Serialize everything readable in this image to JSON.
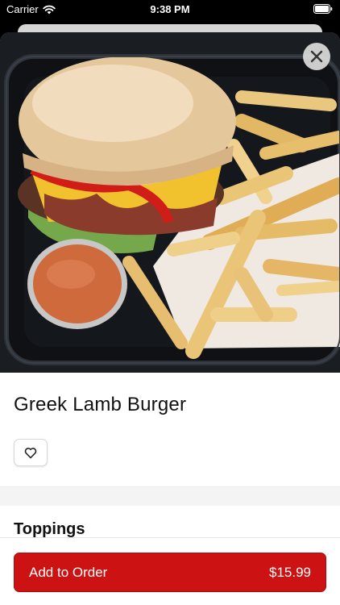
{
  "status_bar": {
    "carrier": "Carrier",
    "time": "9:38 PM"
  },
  "item": {
    "title": "Greek Lamb Burger",
    "image_description_icon": "food-photo",
    "favorite_icon": "heart-outline-icon"
  },
  "sections": [
    {
      "title": "Toppings"
    }
  ],
  "cta": {
    "label": "Add to Order",
    "price": "$15.99"
  },
  "colors": {
    "accent": "#cc1212",
    "background": "#ffffff",
    "band": "#f4f4f4"
  }
}
